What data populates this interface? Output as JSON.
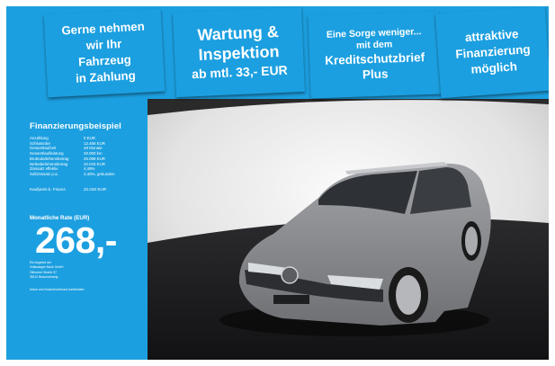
{
  "banners": {
    "inzahlung": [
      "Gerne nehmen",
      "wir Ihr",
      "Fahrzeug",
      "in Zahlung"
    ],
    "wartung": {
      "line1": "Wartung &",
      "line2": "Inspektion",
      "line3": "ab mtl. 33,- EUR"
    },
    "sorge": {
      "line1": "Eine Sorge weniger...",
      "line2": "mit dem",
      "line3": "Kreditschutzbrief",
      "line4": "Plus"
    },
    "finanzierung": [
      "attraktive",
      "Finanzierung",
      "möglich"
    ]
  },
  "finance": {
    "title": "Finanzierungsbeispiel",
    "rows": [
      {
        "label": "Anzahlung",
        "value": "0 EUR"
      },
      {
        "label": "Schlussrate",
        "value": "12.466 EUR"
      },
      {
        "label": "Gesamtlaufzeit",
        "value": "48 Monate"
      },
      {
        "label": "Gesamtlaufleistung",
        "value": "40.000 km"
      },
      {
        "label": "Bruttodarlehensbetrag",
        "value": "25.098 EUR"
      },
      {
        "label": "Nettodarlehensbetrag",
        "value": "22.043 EUR"
      },
      {
        "label": "Zinssatz effektiv",
        "value": "4,49%"
      },
      {
        "label": "Sollzinssatz p.a.",
        "value": "4,40%, gebunden"
      }
    ],
    "kaufpreis_label": "Kaufpreis b. Finanz.",
    "kaufpreis_value": "22.040 EUR",
    "monthly_label": "Monatliche Rate (EUR)",
    "monthly_value": "268,-",
    "dealer_lines": [
      "Ein Angebot der",
      "Volkswagen Bank GmbH",
      "Gifhorner Straße 57",
      "38112 Braunschweig"
    ],
    "footnote": "Irrtum und Zwischenverkauf vorbehalten"
  },
  "colors": {
    "accent": "#1c9fe0",
    "car": "#8a8c90",
    "floor": "#1a1a1c"
  }
}
